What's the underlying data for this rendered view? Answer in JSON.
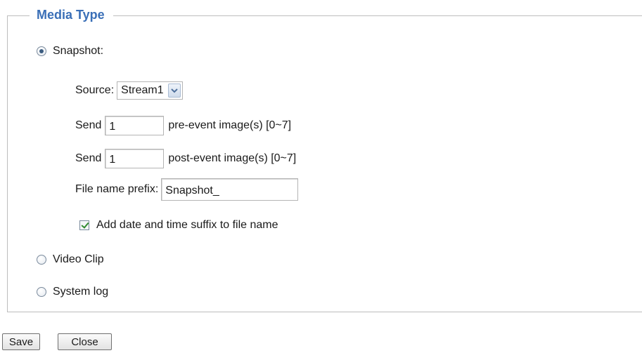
{
  "legend": "Media Type",
  "media_type": {
    "selected": "Snapshot",
    "options": [
      "Snapshot",
      "Video Clip",
      "System log"
    ]
  },
  "snapshot": {
    "label": "Snapshot:",
    "source_label": "Source:",
    "source_value": "Stream1",
    "pre_event": {
      "prefix": "Send",
      "value": "1",
      "suffix": "pre-event image(s) [0~7]"
    },
    "post_event": {
      "prefix": "Send",
      "value": "1",
      "suffix": "post-event image(s) [0~7]"
    },
    "file_prefix_label": "File name prefix:",
    "file_prefix_value": "Snapshot_",
    "add_suffix_label": "Add date and time suffix to file name",
    "add_suffix_checked": true
  },
  "video_clip_label": "Video Clip",
  "system_log_label": "System log",
  "buttons": {
    "save": "Save",
    "close": "Close"
  },
  "icons": {
    "select_arrow": "chevron-down-icon",
    "check_color": "#2f8a2f",
    "legend_color": "#3a6fb7"
  }
}
